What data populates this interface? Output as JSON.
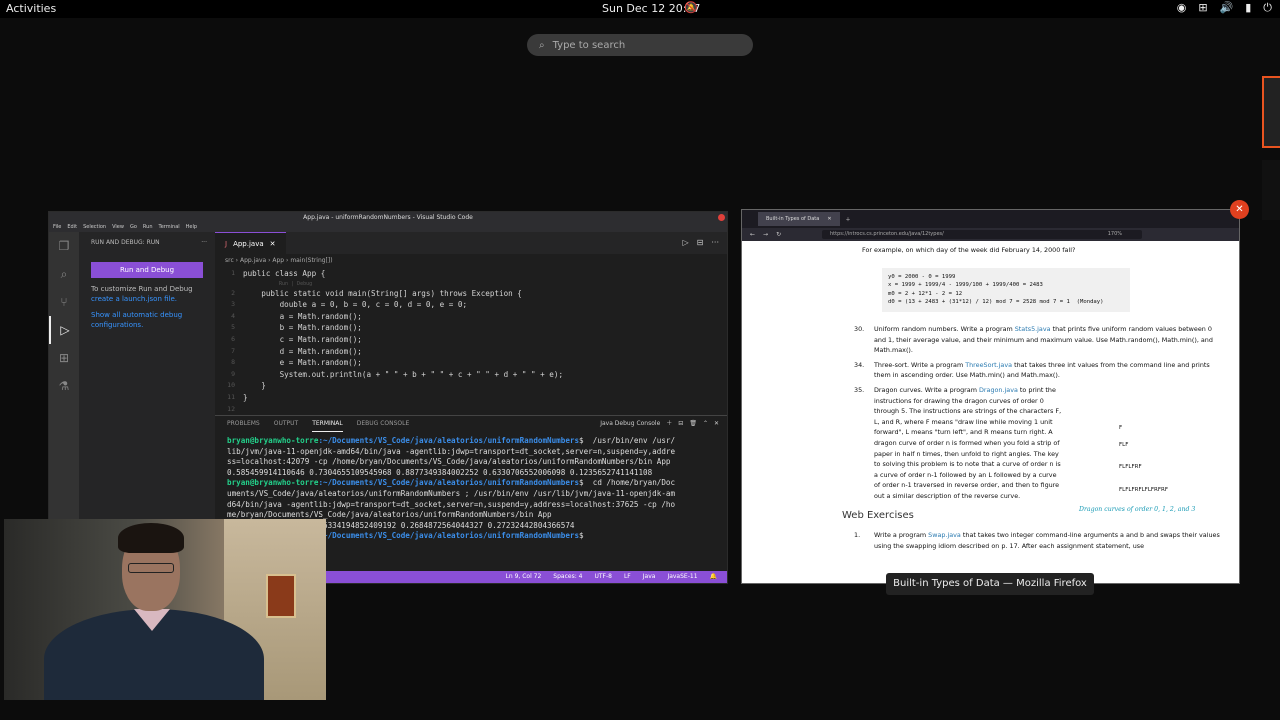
{
  "topbar": {
    "activities": "Activities",
    "clock": "Sun Dec 12  20:07"
  },
  "search": {
    "placeholder": "Type to search"
  },
  "vscode": {
    "title": "App.java - uniformRandomNumbers - Visual Studio Code",
    "menu": [
      "File",
      "Edit",
      "Selection",
      "View",
      "Go",
      "Run",
      "Terminal",
      "Help"
    ],
    "sidebar": {
      "header": "RUN AND DEBUG: RUN",
      "run_button": "Run and Debug",
      "text1": "To customize Run and Debug",
      "link1": "create a launch.json file.",
      "link2": "Show all automatic debug configurations."
    },
    "tab": "App.java",
    "breadcrumb": "src  ›  App.java  ›  App  ›  main(String[])",
    "code_hint": "Run | Debug",
    "code": [
      "public class App {",
      "    public static void main(String[] args) throws Exception {",
      "        double a = 0, b = 0, c = 0, d = 0, e = 0;",
      "        a = Math.random();",
      "        b = Math.random();",
      "        c = Math.random();",
      "        d = Math.random();",
      "        e = Math.random();",
      "        System.out.println(a + \" \" + b + \" \" + c + \" \" + d + \" \" + e);",
      "    }",
      "}",
      ""
    ],
    "line_numbers": [
      "1",
      "2",
      "3",
      "4",
      "5",
      "6",
      "7",
      "8",
      "9",
      "10",
      "11",
      "12"
    ],
    "panel_tabs": [
      "PROBLEMS",
      "OUTPUT",
      "TERMINAL",
      "DEBUG CONSOLE"
    ],
    "panel_right": "Java Debug Console",
    "terminal": {
      "user": "bryan@bryanwho-torre",
      "path": ":~/Documents/VS_Code/java/aleatorios/uniformRandomNumbers",
      "cmd1": "$  /usr/bin/env /usr/",
      "line2": "lib/jvm/java-11-openjdk-amd64/bin/java -agentlib:jdwp=transport=dt_socket,server=n,suspend=y,addre",
      "line3": "ss=localhost:42079 -cp /home/bryan/Documents/VS_Code/java/aleatorios/uniformRandomNumbers/bin App",
      "line4": "0.585459914110646 0.7304655109545968 0.8877349384002252 0.6330706552006098 0.1235652741141108",
      "cmd2": "$  cd /home/bryan/Doc",
      "line6": "uments/VS_Code/java/aleatorios/uniformRandomNumbers ; /usr/bin/env /usr/lib/jvm/java-11-openjdk-am",
      "line7": "d64/bin/java -agentlib:jdwp=transport=dt_socket,server=n,suspend=y,address=localhost:37625 -cp /ho",
      "line8": "me/bryan/Documents/VS_Code/java/aleatorios/uniformRandomNumbers/bin App",
      "line9": "0.4788507886605561 0.6334194852409192 0.2684872564044327 0.27232442804366574",
      "cmd3": "$ "
    },
    "status": [
      "Ln 9, Col 72",
      "Spaces: 4",
      "UTF-8",
      "LF",
      "Java",
      "JavaSE-11"
    ]
  },
  "firefox": {
    "tab": "Built-in Types of Data",
    "url": "https://introcs.cs.princeton.edu/java/12types/",
    "zoom": "170%",
    "intro": "For example, on which day of the week did February 14, 2000 fall?",
    "codebox": "y0 = 2000 - 0 = 1999\nx = 1999 + 1999/4 - 1999/100 + 1999/400 = 2483\nm0 = 2 + 12*1 - 2 = 12\nd0 = (13 + 2483 + (31*12) / 12) mod 7 = 2528 mod 7 = 1  (Monday)",
    "ex30_num": "30.",
    "ex30_a": "Uniform random numbers. Write a program ",
    "ex30_link": "Stats5.java",
    "ex30_b": " that prints five uniform random values between 0 and 1, their average value, and their minimum and maximum value. Use Math.random(), Math.min(), and Math.max().",
    "ex34_num": "34.",
    "ex34_a": "Three-sort. Write a program ",
    "ex34_link": "ThreeSort.java",
    "ex34_b": " that takes three int values from the command line and prints them in ascending order. Use Math.min() and Math.max().",
    "ex35_num": "35.",
    "ex35_a": "Dragon curves. Write a program ",
    "ex35_link": "Dragon.java",
    "ex35_b": " to print the instructions for drawing the dragon curves of order 0 through 5. The instructions are strings of the characters F, L, and R, where F means \"draw line while moving 1 unit forward\", L means \"turn left\", and R means turn right. A dragon curve of order n is formed when you fold a strip of paper in half n times, then unfold to right angles. The key to solving this problem is to note that a curve of order n is a curve of order n-1 followed by an L followed by a curve of order n-1 traversed in reverse order, and then to figure out a similar description of the reverse curve.",
    "dragon_labels": [
      "F",
      "FLF",
      "FLFLFRF",
      "FLFLFRFLFLFRFRF"
    ],
    "dragon_caption": "Dragon curves of order 0, 1, 2, and 3",
    "web_exercises": "Web Exercises",
    "web1_num": "1.",
    "web1_a": "Write a program ",
    "web1_link": "Swap.java",
    "web1_b": " that takes two integer command-line arguments a and b and swaps their values using the swapping idiom described on p. 17. After each assignment statement, use"
  },
  "firefox_label": "Built-in Types of Data — Mozilla Firefox",
  "icons": [
    "search-icon",
    "bell-off-icon",
    "network-icon",
    "volume-icon",
    "power-icon",
    "close-icon"
  ]
}
